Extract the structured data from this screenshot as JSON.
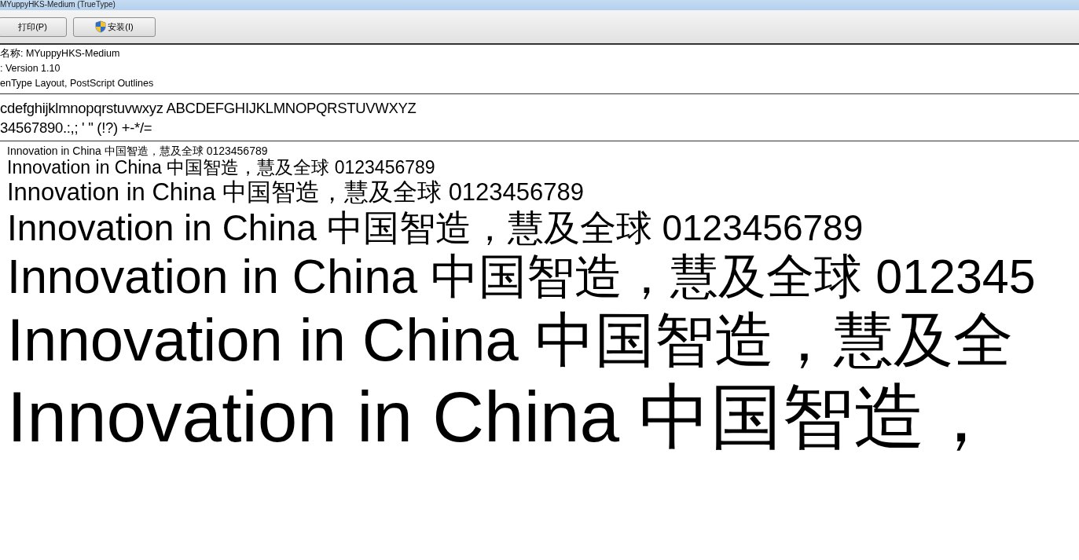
{
  "window": {
    "title": "MYuppyHKS-Medium (TrueType)"
  },
  "toolbar": {
    "buttons": [
      {
        "label": "打印(P)",
        "kind": "plain"
      },
      {
        "label": "安装(I)",
        "kind": "shield"
      }
    ]
  },
  "info": [
    "名称: MYuppyHKS-Medium",
    ": Version 1.10",
    "enType Layout, PostScript Outlines"
  ],
  "charset": [
    "cdefghijklmnopqrstuvwxyz ABCDEFGHIJKLMNOPQRSTUVWXYZ",
    "34567890.:,; ' \" (!?) +-*/="
  ],
  "samples": [
    "Innovation in China 中国智造，慧及全球 0123456789",
    "Innovation in China 中国智造，慧及全球 0123456789",
    "Innovation in China 中国智造，慧及全球 0123456789",
    "Innovation in China 中国智造，慧及全球 0123456789",
    "Innovation in China 中国智造，慧及全球 012345",
    "Innovation in China 中国智造，慧及全",
    "Innovation in China 中国智造，"
  ]
}
